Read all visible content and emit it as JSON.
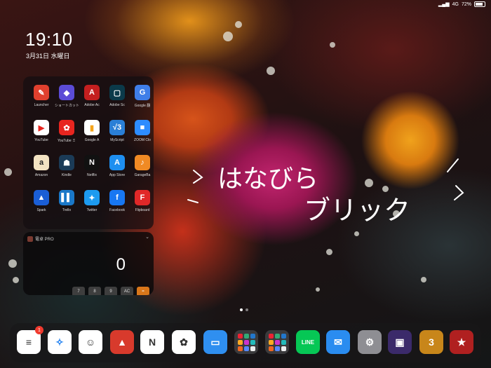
{
  "status_bar": {
    "signal": "4G",
    "battery_text": "72%"
  },
  "lock": {
    "time": "19:10",
    "date": "3月31日 水曜日"
  },
  "widget_apps": [
    {
      "label": "Launcher",
      "icon": "launcher-icon",
      "color": "#e0402e",
      "glyph": "✎"
    },
    {
      "label": "ショートカット",
      "icon": "shortcuts-icon",
      "color": "#5b4bd6",
      "glyph": "◆"
    },
    {
      "label": "Adobe Ac",
      "icon": "adobe-acrobat-icon",
      "color": "#c41f1f",
      "glyph": "A"
    },
    {
      "label": "Adobe Sc",
      "icon": "adobe-scan-icon",
      "color": "#0b3a4a",
      "glyph": "▢"
    },
    {
      "label": "Google 翻",
      "icon": "google-translate-icon",
      "color": "#3f7ee8",
      "glyph": "G"
    },
    {
      "label": "YouTube",
      "icon": "youtube-icon",
      "color": "#ffffff",
      "glyph": "▶"
    },
    {
      "label": "YouTube ミ",
      "icon": "youtube-music-icon",
      "color": "#e8251f",
      "glyph": "✿"
    },
    {
      "label": "Google A",
      "icon": "google-analytics-icon",
      "color": "#ffffff",
      "glyph": "▮"
    },
    {
      "label": "MyScript",
      "icon": "myscript-calculator-icon",
      "color": "#2a7fd6",
      "glyph": "√3"
    },
    {
      "label": "ZOOM Clo",
      "icon": "zoom-icon",
      "color": "#2d8cff",
      "glyph": "■"
    },
    {
      "label": "Amazon",
      "icon": "amazon-icon",
      "color": "#f3e3c2",
      "glyph": "a"
    },
    {
      "label": "Kindle",
      "icon": "kindle-icon",
      "color": "#1b3b57",
      "glyph": "☗"
    },
    {
      "label": "Netflix",
      "icon": "netflix-icon",
      "color": "#111111",
      "glyph": "N"
    },
    {
      "label": "App Store",
      "icon": "app-store-icon",
      "color": "#1e8ff0",
      "glyph": "A"
    },
    {
      "label": "GarageBa",
      "icon": "garageband-icon",
      "color": "#f08a24",
      "glyph": "♪"
    },
    {
      "label": "Spark",
      "icon": "spark-icon",
      "color": "#1a5ed6",
      "glyph": "▲"
    },
    {
      "label": "Trello",
      "icon": "trello-icon",
      "color": "#1a78c8",
      "glyph": "▌▌"
    },
    {
      "label": "Twitter",
      "icon": "twitter-icon",
      "color": "#1d9bf0",
      "glyph": "✦"
    },
    {
      "label": "Facebook",
      "icon": "facebook-icon",
      "color": "#1877f2",
      "glyph": "f"
    },
    {
      "label": "Flipboard",
      "icon": "flipboard-icon",
      "color": "#e12828",
      "glyph": "F"
    }
  ],
  "calculator_widget": {
    "title": "電卓 PRO",
    "display": "0",
    "keys": [
      "7",
      "8",
      "9",
      "AC",
      "="
    ]
  },
  "wallpaper_text": {
    "line1": "はなびら",
    "line2": "ブリック"
  },
  "page_dots": 2,
  "dock": [
    {
      "name": "reminders-icon",
      "color": "#ffffff",
      "glyph": "≡",
      "badge": "1"
    },
    {
      "name": "safari-icon",
      "color": "#ffffff",
      "glyph": "✧"
    },
    {
      "name": "mindnode-icon",
      "color": "#ffffff",
      "glyph": "☺"
    },
    {
      "name": "bear-icon",
      "color": "#d83a2c",
      "glyph": "▲"
    },
    {
      "name": "notion-icon",
      "color": "#ffffff",
      "glyph": "N"
    },
    {
      "name": "photos-icon",
      "color": "#ffffff",
      "glyph": "✿"
    },
    {
      "name": "files-icon",
      "color": "#2f8ff0",
      "glyph": "▭"
    },
    {
      "name": "folder-1-icon",
      "color": "#3a3a3c",
      "glyph": ""
    },
    {
      "name": "folder-2-icon",
      "color": "#3a3a3c",
      "glyph": ""
    },
    {
      "name": "line-icon",
      "color": "#06c755",
      "glyph": "LINE"
    },
    {
      "name": "mail-icon",
      "color": "#2a8cf0",
      "glyph": "✉"
    },
    {
      "name": "settings-icon",
      "color": "#8e8e93",
      "glyph": "⚙"
    },
    {
      "name": "game-icon",
      "color": "#3b2a6a",
      "glyph": "▣"
    },
    {
      "name": "dragon-quest-icon",
      "color": "#c8861a",
      "glyph": "3"
    },
    {
      "name": "game-2-icon",
      "color": "#b02020",
      "glyph": "★"
    }
  ]
}
